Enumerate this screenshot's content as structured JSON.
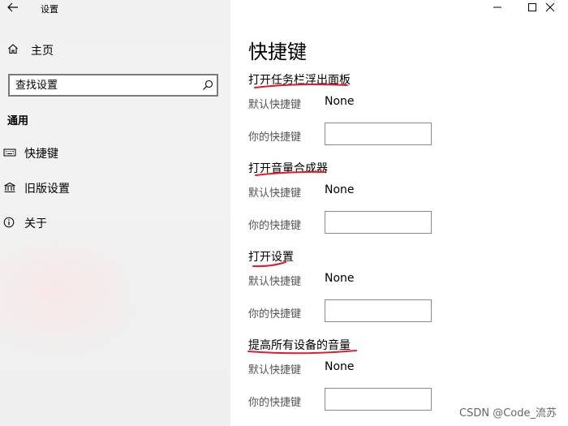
{
  "window": {
    "app_title": "设置",
    "controls": [
      "minimize",
      "maximize",
      "close"
    ]
  },
  "sidebar": {
    "home_label": "主页",
    "search": {
      "placeholder": "查找设置",
      "icon": "search-icon"
    },
    "section_label": "通用",
    "items": [
      {
        "label": "快捷键",
        "icon": "keyboard-icon"
      },
      {
        "label": "旧版设置",
        "icon": "bank-icon"
      },
      {
        "label": "关于",
        "icon": "info-icon"
      }
    ]
  },
  "main": {
    "title": "快捷键",
    "default_label": "默认快捷键",
    "custom_label": "你的快捷键",
    "groups": [
      {
        "title": "打开任务栏浮出面板",
        "default_value": "None",
        "custom_value": ""
      },
      {
        "title": "打开音量合成器",
        "default_value": "None",
        "custom_value": ""
      },
      {
        "title": "打开设置",
        "default_value": "None",
        "custom_value": ""
      },
      {
        "title": "提高所有设备的音量",
        "default_value": "None",
        "custom_value": ""
      }
    ],
    "annotation_color": "#e8192c"
  },
  "watermark": "CSDN @Code_流苏"
}
